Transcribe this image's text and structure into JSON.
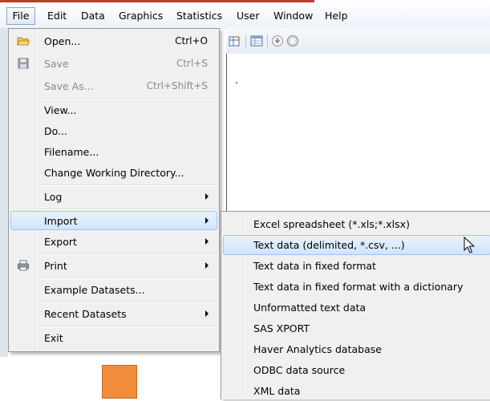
{
  "menubar": {
    "items": [
      {
        "label": "File"
      },
      {
        "label": "Edit"
      },
      {
        "label": "Data"
      },
      {
        "label": "Graphics"
      },
      {
        "label": "Statistics"
      },
      {
        "label": "User"
      },
      {
        "label": "Window"
      },
      {
        "label": "Help"
      }
    ]
  },
  "results": {
    "text": "."
  },
  "file_menu": {
    "items": [
      {
        "label": "Open...",
        "shortcut": "Ctrl+O",
        "icon": "open-folder-icon",
        "enabled": true
      },
      {
        "label": "Save",
        "shortcut": "Ctrl+S",
        "icon": "save-disk-icon",
        "enabled": false
      },
      {
        "label": "Save As...",
        "shortcut": "Ctrl+Shift+S",
        "enabled": false
      },
      {
        "label": "View...",
        "enabled": true
      },
      {
        "label": "Do...",
        "enabled": true
      },
      {
        "label": "Filename...",
        "enabled": true
      },
      {
        "label": "Change Working Directory...",
        "enabled": true
      },
      {
        "label": "Log",
        "submenu": true
      },
      {
        "label": "Import",
        "submenu": true,
        "highlighted": true
      },
      {
        "label": "Export",
        "submenu": true
      },
      {
        "label": "Print",
        "submenu": true,
        "icon": "printer-icon"
      },
      {
        "label": "Example Datasets..."
      },
      {
        "label": "Recent Datasets",
        "submenu": true
      },
      {
        "label": "Exit"
      }
    ]
  },
  "import_submenu": {
    "items": [
      {
        "label": "Excel spreadsheet (*.xls;*.xlsx)"
      },
      {
        "label": "Text data (delimited, *.csv, ...)",
        "highlighted": true
      },
      {
        "label": "Text data in fixed format"
      },
      {
        "label": "Text data in fixed format with a dictionary"
      },
      {
        "label": "Unformatted text data"
      },
      {
        "label": "SAS XPORT"
      },
      {
        "label": "Haver Analytics database"
      },
      {
        "label": "ODBC data source"
      },
      {
        "label": "XML data"
      }
    ]
  },
  "colors": {
    "highlight": "#cfe4fb",
    "highlight_border": "#9ec6ef",
    "menu_bg": "#f0f0f0",
    "accent_red": "#c0392b",
    "orange": "#f08c3c"
  }
}
